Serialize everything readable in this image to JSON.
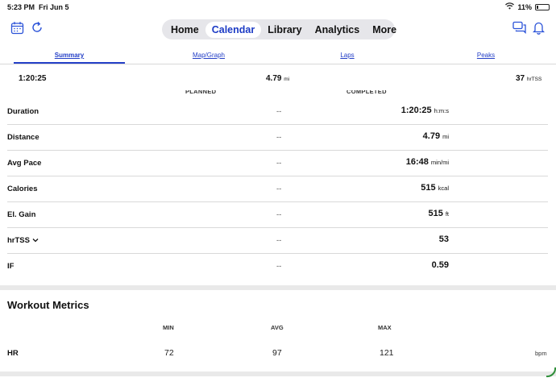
{
  "status_bar": {
    "time": "5:23 PM",
    "date": "Fri Jun 5",
    "battery": "11%",
    "battery_level": 0.11
  },
  "nav": {
    "items": [
      "Home",
      "Calendar",
      "Library",
      "Analytics",
      "More"
    ],
    "active": "Calendar"
  },
  "tabs": [
    "Summary",
    "Map/Graph",
    "Laps",
    "Peaks"
  ],
  "summary": {
    "duration": "1:20:25",
    "distance": "4.79",
    "distance_unit": "mi",
    "tss": "37",
    "tss_unit": "hrTSS"
  },
  "table": {
    "planned_header": "PLANNED",
    "completed_header": "COMPLETED",
    "rows": [
      {
        "label": "Duration",
        "planned": "--",
        "completed": "1:20:25",
        "unit": "h:m:s"
      },
      {
        "label": "Distance",
        "planned": "--",
        "completed": "4.79",
        "unit": "mi"
      },
      {
        "label": "Avg Pace",
        "planned": "--",
        "completed": "16:48",
        "unit": "min/mi"
      },
      {
        "label": "Calories",
        "planned": "--",
        "completed": "515",
        "unit": "kcal"
      },
      {
        "label": "El. Gain",
        "planned": "--",
        "completed": "515",
        "unit": "ft"
      },
      {
        "label": "hrTSS",
        "planned": "--",
        "completed": "53",
        "unit": ""
      },
      {
        "label": "IF",
        "planned": "--",
        "completed": "0.59",
        "unit": ""
      }
    ]
  },
  "workout_metrics": {
    "title": "Workout Metrics",
    "headers": {
      "min": "MIN",
      "avg": "AVG",
      "max": "MAX"
    },
    "hr": {
      "label": "HR",
      "min": "72",
      "avg": "97",
      "max": "121",
      "unit": "bpm"
    }
  },
  "colors": {
    "accent": "#1c3bc5",
    "active_pill": "#ffffff",
    "nav_bg": "#e6e6ea"
  }
}
